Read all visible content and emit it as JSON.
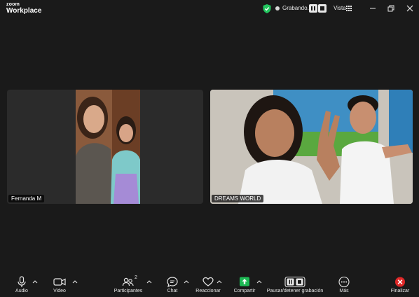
{
  "app": {
    "logo_top": "zoom",
    "logo_main": "Workplace"
  },
  "titlebar": {
    "recording_label": "Grabando...",
    "view_label": "Vista"
  },
  "participants": [
    {
      "name": "Fernanda M"
    },
    {
      "name": "DREAMS WORLD"
    }
  ],
  "toolbar": {
    "audio": "Audio",
    "video": "Video",
    "participants": "Participantes",
    "participants_count": "2",
    "chat": "Chat",
    "react": "Reaccionar",
    "share": "Compartir",
    "pause_stop_recording": "Pausar/detener grabación",
    "more": "Más",
    "end": "Finalizar"
  },
  "colors": {
    "background": "#1a1a1a",
    "share_accent": "#1db954",
    "end_accent": "#e02828",
    "shield_accent": "#22c55e"
  }
}
